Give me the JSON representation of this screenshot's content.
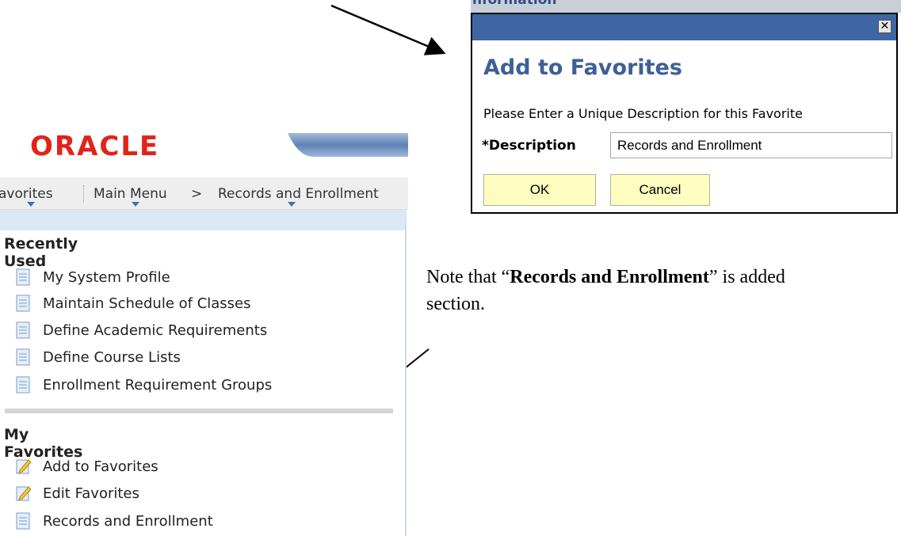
{
  "oracle_logo_text": "ORACLE",
  "navbar": {
    "favorites": "avorites",
    "main_menu": "Main Menu",
    "separator": ">",
    "records": "Records and Enrollment"
  },
  "recently_used": {
    "title": "Recently Used",
    "items": [
      {
        "label": "My System Profile",
        "icon": "document-icon"
      },
      {
        "label": "Maintain Schedule of Classes",
        "icon": "document-icon"
      },
      {
        "label": "Define Academic Requirements",
        "icon": "document-icon"
      },
      {
        "label": "Define Course Lists",
        "icon": "document-icon"
      },
      {
        "label": "Enrollment Requirement Groups",
        "icon": "document-icon"
      }
    ]
  },
  "my_favorites": {
    "title": "My Favorites",
    "items": [
      {
        "label": "Add to Favorites",
        "icon": "edit-pencil-icon"
      },
      {
        "label": "Edit Favorites",
        "icon": "edit-pencil-icon"
      },
      {
        "label": "Records and Enrollment",
        "icon": "document-icon"
      }
    ]
  },
  "dialog": {
    "behind_text": "nformation",
    "close_glyph": "✕",
    "heading": "Add to Favorites",
    "instruction": "Please Enter a Unique Description for this Favorite",
    "description_label": "*Description",
    "description_value": "Records and Enrollment",
    "ok_label": "OK",
    "cancel_label": "Cancel"
  },
  "note": {
    "prefix": "Note that “",
    "bold": "Records and Enrollment",
    "suffix": "” is added",
    "line2": "section."
  },
  "colors": {
    "oracle_red": "#e2231a",
    "dialog_blue": "#3e66a5",
    "heading_blue": "#3e5f97",
    "button_yellow": "#fefdc0",
    "nav_caret_blue": "#3d6fb0"
  }
}
